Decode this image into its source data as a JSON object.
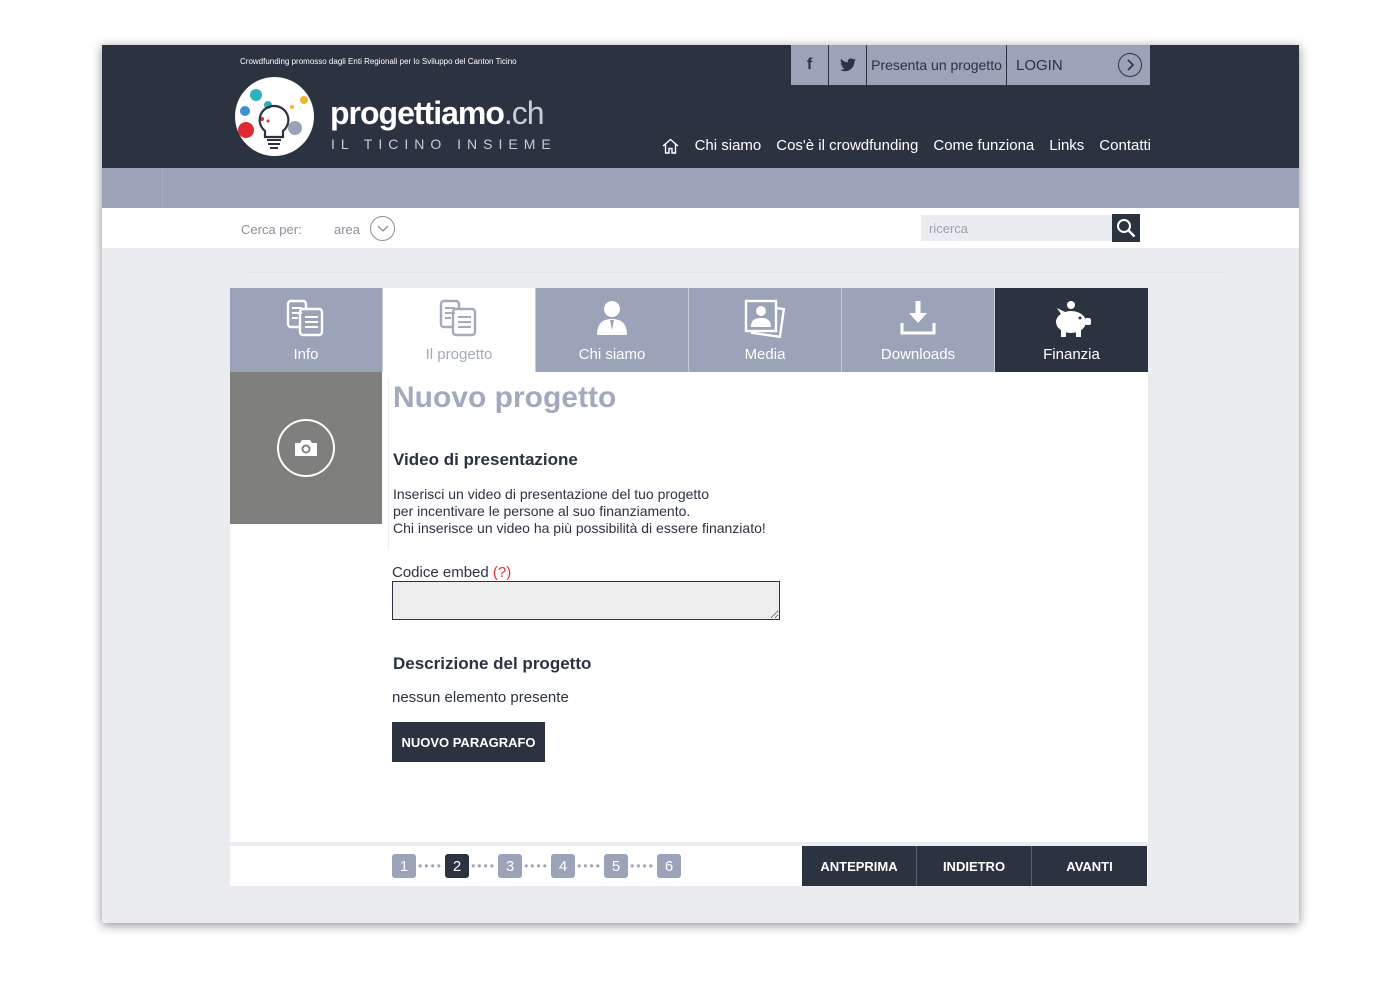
{
  "header": {
    "tagline": "Crowdfunding promosso dagli Enti Regionali per lo Sviluppo del Canton Ticino",
    "brand_main": "progettiamo",
    "brand_suffix": ".ch",
    "brand_subtitle": "IL TICINO INSIEME",
    "facebook_label": "f",
    "presenta_label": "Presenta un progetto",
    "login_label": "LOGIN",
    "nav": [
      "Chi siamo",
      "Cos'è il crowdfunding",
      "Come funziona",
      "Links",
      "Contatti"
    ]
  },
  "search": {
    "cerca_label": "Cerca per:",
    "area_label": "area",
    "placeholder": "ricerca"
  },
  "tabs": [
    {
      "label": "Info",
      "icon": "documents-icon"
    },
    {
      "label": "Il progetto",
      "icon": "documents-icon"
    },
    {
      "label": "Chi siamo",
      "icon": "person-icon"
    },
    {
      "label": "Media",
      "icon": "photos-icon"
    },
    {
      "label": "Downloads",
      "icon": "download-icon"
    },
    {
      "label": "Finanzia",
      "icon": "piggy-bank-icon"
    }
  ],
  "main": {
    "title": "Nuovo progetto",
    "video_heading": "Video di presentazione",
    "intro_lines": [
      "Inserisci un video di presentazione del tuo progetto",
      "per incentivare le persone al suo finanziamento.",
      "Chi inserisce un video ha più possibilità di essere finanziato!"
    ],
    "embed_label": "Codice embed",
    "embed_help": "(?)",
    "desc_heading": "Descrizione del progetto",
    "empty_text": "nessun elemento presente",
    "new_paragraph_label": "NUOVO PARAGRAFO"
  },
  "footer": {
    "steps": [
      "1",
      "2",
      "3",
      "4",
      "5",
      "6"
    ],
    "current_step": "2",
    "preview_label": "ANTEPRIMA",
    "back_label": "INDIETRO",
    "next_label": "AVANTI"
  },
  "colors": {
    "dark": "#2b3240",
    "slate": "#9aa3b8",
    "photo_bg": "#7f7f7d",
    "help_red": "#e03030"
  }
}
